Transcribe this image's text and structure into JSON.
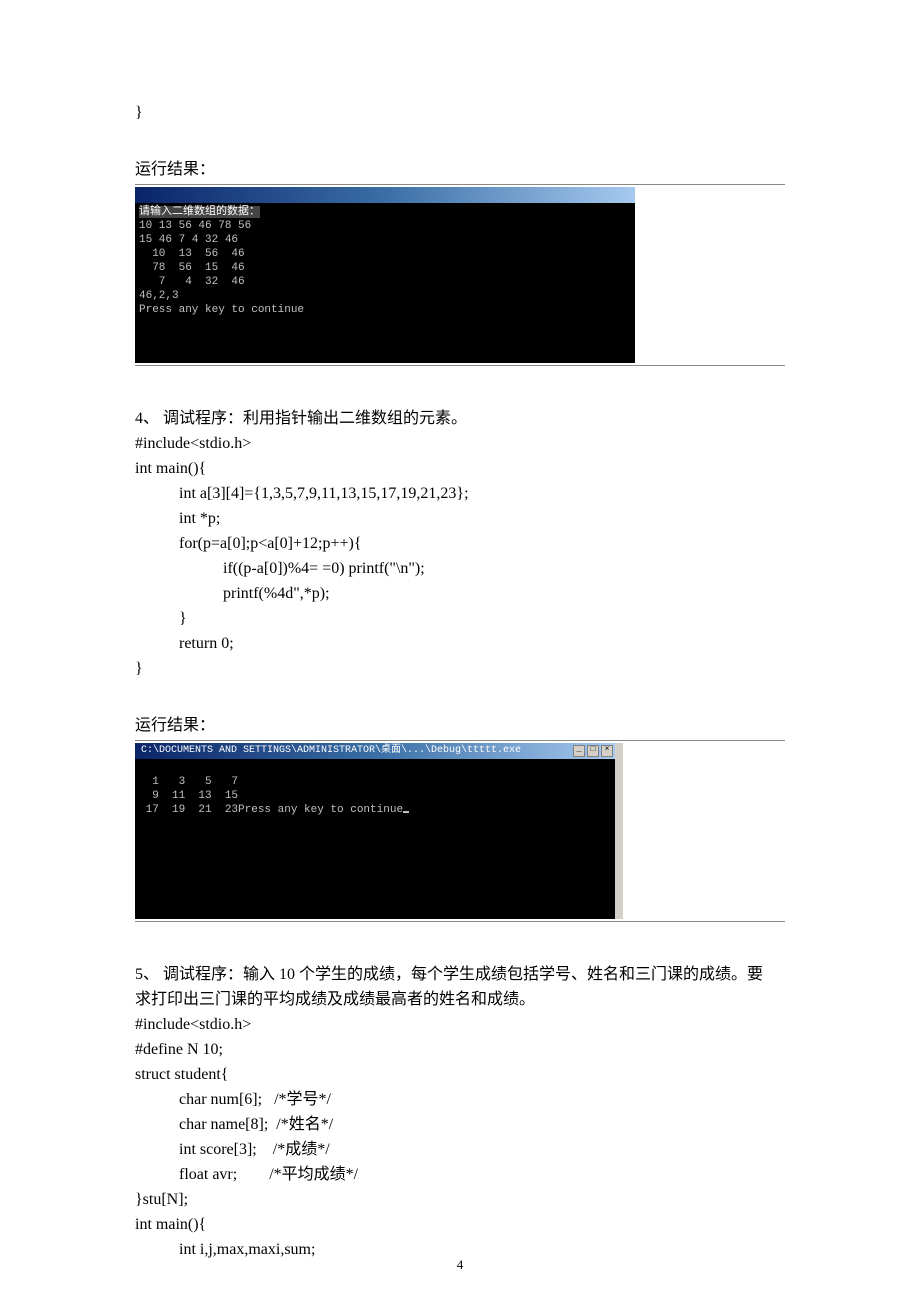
{
  "top_closing_brace": "}",
  "result_label": "运行结果：",
  "console1": {
    "prompt_line": "请输入二维数组的数据：",
    "lines": [
      "10 13 56 46 78 56",
      "15 46 7 4 32 46",
      "  10  13  56  46",
      "  78  56  15  46",
      "   7   4  32  46",
      "46,2,3",
      "Press any key to continue"
    ]
  },
  "section4": {
    "title": "4、  调试程序：利用指针输出二维数组的元素。",
    "code": [
      "#include<stdio.h>",
      "int main(){",
      "int a[3][4]={1,3,5,7,9,11,13,15,17,19,21,23};",
      "int *p;",
      "for(p=a[0];p<a[0]+12;p++){",
      "if((p-a[0])%4= =0) printf(\"\\n\");",
      "printf(%4d\",*p);",
      "}",
      "return 0;",
      "}"
    ],
    "indent": [
      0,
      0,
      1,
      1,
      1,
      2,
      2,
      1,
      1,
      0
    ]
  },
  "console2": {
    "titlepath": "C:\\DOCUMENTS AND SETTINGS\\ADMINISTRATOR\\桌面\\...\\Debug\\ttttt.exe",
    "buttons": [
      "_",
      "□",
      "×"
    ],
    "lines": [
      "",
      "  1   3   5   7",
      "  9  11  13  15",
      " 17  19  21  23Press any key to continue"
    ]
  },
  "section5": {
    "title_a": "5、  调试程序：输入 10 个学生的成绩，每个学生成绩包括学号、姓名和三门课的成绩。要",
    "title_b": "求打印出三门课的平均成绩及成绩最高者的姓名和成绩。",
    "code_lines": [
      {
        "t": "#include<stdio.h>",
        "i": 0
      },
      {
        "t": "#define N 10;",
        "i": 0
      },
      {
        "t": "struct student{",
        "i": 0
      },
      {
        "t": "char num[6];   /*学号*/",
        "i": 1
      },
      {
        "t": "char name[8];  /*姓名*/",
        "i": 1
      },
      {
        "t": "int score[3];    /*成绩*/",
        "i": 1
      },
      {
        "t": "float avr;        /*平均成绩*/",
        "i": 1
      },
      {
        "t": "}stu[N];",
        "i": 0
      },
      {
        "t": "int main(){",
        "i": 0
      },
      {
        "t": "int i,j,max,maxi,sum;",
        "i": 1
      }
    ]
  },
  "page_number": "4"
}
